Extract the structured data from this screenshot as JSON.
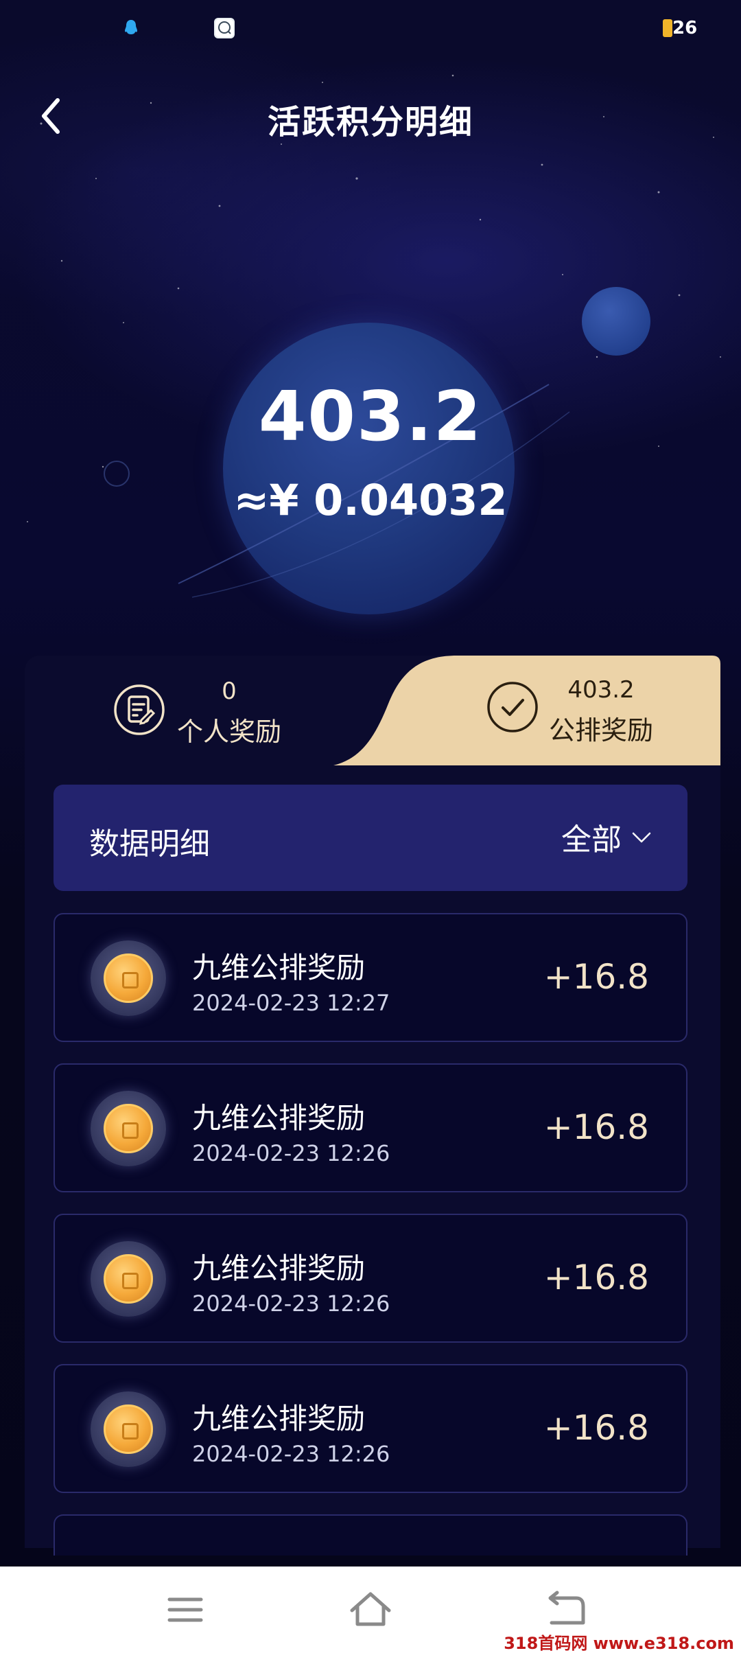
{
  "status_bar": {
    "battery": "26"
  },
  "header": {
    "title": "活跃积分明细"
  },
  "balance": {
    "value": "403.2",
    "rmb": "≈¥ 0.04032"
  },
  "tabs": [
    {
      "count": "0",
      "label": "个人奖励",
      "active": false
    },
    {
      "count": "403.2",
      "label": "公排奖励",
      "active": true
    }
  ],
  "filter": {
    "title": "数据明细",
    "selected": "全部"
  },
  "records": [
    {
      "title": "九维公排奖励",
      "time": "2024-02-23 12:27",
      "amount": "+16.8"
    },
    {
      "title": "九维公排奖励",
      "time": "2024-02-23 12:26",
      "amount": "+16.8"
    },
    {
      "title": "九维公排奖励",
      "time": "2024-02-23 12:26",
      "amount": "+16.8"
    },
    {
      "title": "九维公排奖励",
      "time": "2024-02-23 12:26",
      "amount": "+16.8"
    }
  ],
  "watermark": "318首码网 www.e318.com",
  "colors": {
    "accent_gold": "#f2e3c8",
    "tab_active_bg": "#ecd3a8",
    "filter_bg": "#23236e"
  }
}
